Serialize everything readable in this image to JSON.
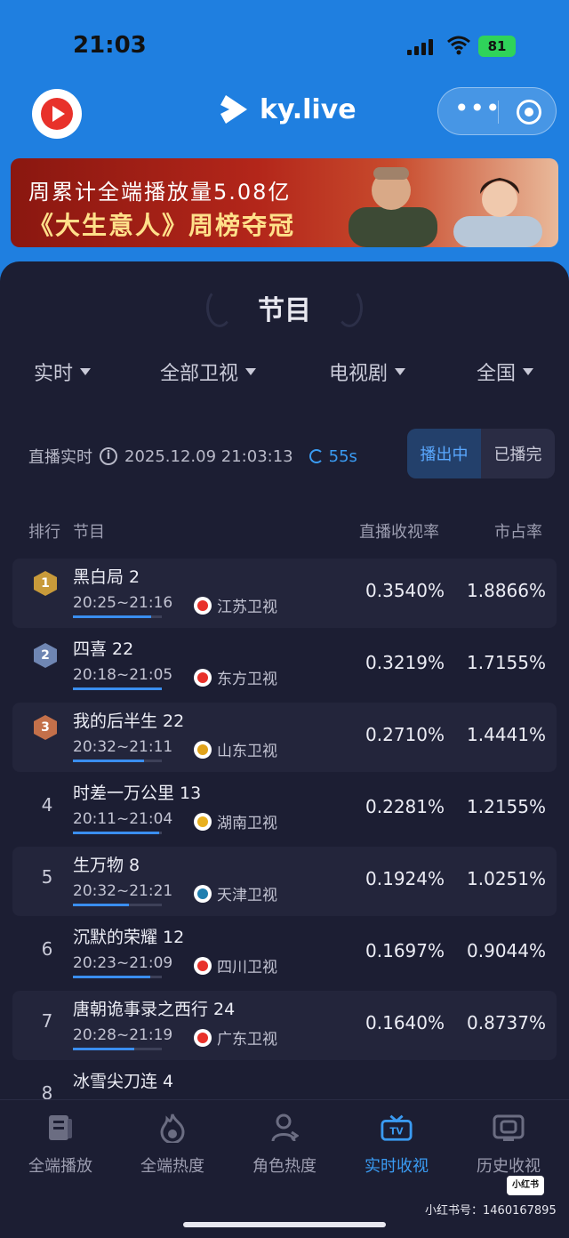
{
  "status_bar": {
    "time": "21:03",
    "battery": "81"
  },
  "app": {
    "name": "ky.live"
  },
  "banner": {
    "line1": "周累计全端播放量5.08亿",
    "line2": "《大生意人》周榜夺冠"
  },
  "section": {
    "title": "节目"
  },
  "filters": [
    {
      "label": "实时"
    },
    {
      "label": "全部卫视"
    },
    {
      "label": "电视剧"
    },
    {
      "label": "全国"
    }
  ],
  "live": {
    "label": "直播实时",
    "timestamp": "2025.12.09 21:03:13",
    "refresh": "55s"
  },
  "segment": {
    "on_air": "播出中",
    "finished": "已播完",
    "selected": "播出中"
  },
  "table": {
    "headers": {
      "rank": "排行",
      "program": "节目",
      "rating": "直播收视率",
      "share": "市占率"
    },
    "rows": [
      {
        "rank": "1",
        "program": "黑白局 2",
        "time": "20:25~21:16",
        "channel": "江苏卫视",
        "rating": "0.3540%",
        "share": "1.8866%",
        "progress": 0.88,
        "medal": "gold"
      },
      {
        "rank": "2",
        "program": "四喜 22",
        "time": "20:18~21:05",
        "channel": "东方卫视",
        "rating": "0.3219%",
        "share": "1.7155%",
        "progress": 1.0,
        "medal": "silver"
      },
      {
        "rank": "3",
        "program": "我的后半生 22",
        "time": "20:32~21:11",
        "channel": "山东卫视",
        "rating": "0.2710%",
        "share": "1.4441%",
        "progress": 0.8,
        "medal": "bronze"
      },
      {
        "rank": "4",
        "program": "时差一万公里 13",
        "time": "20:11~21:04",
        "channel": "湖南卫视",
        "rating": "0.2281%",
        "share": "1.2155%",
        "progress": 0.97,
        "medal": ""
      },
      {
        "rank": "5",
        "program": "生万物 8",
        "time": "20:32~21:21",
        "channel": "天津卫视",
        "rating": "0.1924%",
        "share": "1.0251%",
        "progress": 0.63,
        "medal": ""
      },
      {
        "rank": "6",
        "program": "沉默的荣耀 12",
        "time": "20:23~21:09",
        "channel": "四川卫视",
        "rating": "0.1697%",
        "share": "0.9044%",
        "progress": 0.87,
        "medal": ""
      },
      {
        "rank": "7",
        "program": "唐朝诡事录之西行 24",
        "time": "20:28~21:19",
        "channel": "广东卫视",
        "rating": "0.1640%",
        "share": "0.8737%",
        "progress": 0.69,
        "medal": ""
      },
      {
        "rank": "8",
        "program": "冰雪尖刀连 4",
        "time": "",
        "channel": "",
        "rating": "",
        "share": "",
        "progress": 0,
        "medal": ""
      }
    ]
  },
  "tabs": [
    {
      "label": "全端播放",
      "icon": "playlist-icon"
    },
    {
      "label": "全端热度",
      "icon": "flame-icon"
    },
    {
      "label": "角色热度",
      "icon": "person-icon"
    },
    {
      "label": "实时收视",
      "icon": "tv-icon",
      "active": true
    },
    {
      "label": "历史收视",
      "icon": "history-icon"
    }
  ],
  "watermark": {
    "badge": "小红书",
    "id": "小红书号：1460167895"
  },
  "colors": {
    "accent": "#3a9bf2",
    "background": "#1c1e33",
    "header_blue": "#1f7fe0"
  }
}
